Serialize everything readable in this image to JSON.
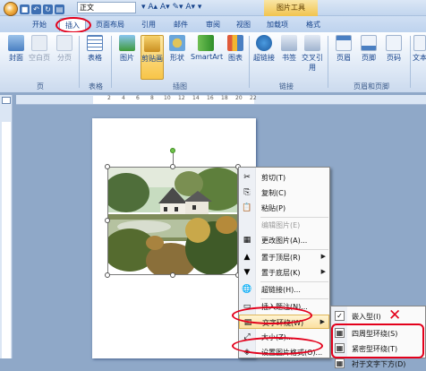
{
  "qat": {
    "style_box": "正文"
  },
  "contextual_tab": "图片工具",
  "tabs": [
    "开始",
    "插入",
    "页面布局",
    "引用",
    "邮件",
    "审阅",
    "视图",
    "加载项",
    "格式"
  ],
  "ribbon": {
    "buttons": [
      "封面",
      "空白页",
      "分页",
      "表格",
      "图片",
      "剪贴画",
      "形状",
      "SmartArt",
      "图表",
      "超链接",
      "书签",
      "交叉引用",
      "页眉",
      "页脚",
      "页码",
      "文本"
    ],
    "groups": [
      "页",
      "表格",
      "插图",
      "链接",
      "页眉和页脚"
    ]
  },
  "ruler_numbers": [
    "2",
    "4",
    "6",
    "8",
    "10",
    "12",
    "14",
    "16",
    "18",
    "20",
    "22"
  ],
  "context_menu": [
    {
      "label": "剪切(T)",
      "icon": "✂",
      "disabled": false
    },
    {
      "label": "复制(C)",
      "icon": "⎘",
      "disabled": false
    },
    {
      "label": "粘贴(P)",
      "icon": "📋",
      "disabled": false
    },
    {
      "label": "编辑图片(E)",
      "icon": "",
      "disabled": true
    },
    {
      "label": "更改图片(A)...",
      "icon": "▦",
      "disabled": false
    },
    {
      "label": "置于顶层(R)",
      "icon": "▲",
      "disabled": false,
      "arrow": "▶"
    },
    {
      "label": "置于底层(K)",
      "icon": "▼",
      "disabled": false,
      "arrow": "▶"
    },
    {
      "label": "超链接(H)...",
      "icon": "🌐",
      "disabled": false
    },
    {
      "label": "插入题注(N)...",
      "icon": "▭",
      "disabled": false
    },
    {
      "label": "文字环绕(W)",
      "icon": "▤",
      "disabled": false,
      "arrow": "▶",
      "selected": true
    },
    {
      "label": "大小(Z)...",
      "icon": "⤢",
      "disabled": false
    },
    {
      "label": "设置图片格式(O)...",
      "icon": "◈",
      "disabled": false
    }
  ],
  "submenu": [
    {
      "label": "嵌入型(I)"
    },
    {
      "label": "四周型环绕(S)"
    },
    {
      "label": "紧密型环绕(T)"
    },
    {
      "label": "衬于文字下方(D)"
    }
  ]
}
